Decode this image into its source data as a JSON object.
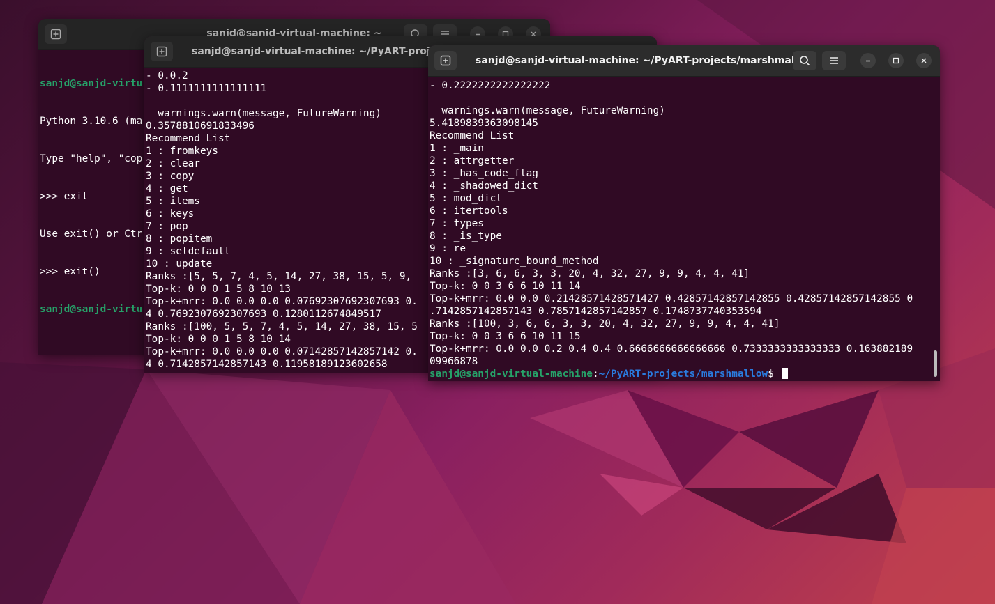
{
  "window1": {
    "title": "sanjd@sanjd-virtual-machine: ~",
    "lines": [
      {
        "user": "sanjd@sanjd-virtu",
        "text": ""
      },
      {
        "text": "Python 3.10.6 (ma"
      },
      {
        "text": "Type \"help\", \"cop"
      },
      {
        "text": ">>> exit"
      },
      {
        "text": "Use exit() or Ctr"
      },
      {
        "text": ">>> exit()"
      },
      {
        "user": "sanjd@sanjd-virtu",
        "text": ""
      }
    ]
  },
  "window2": {
    "title": "sanjd@sanjd-virtual-machine: ~/PyART-projects",
    "lines": [
      "- 0.0.2",
      "- 0.1111111111111111",
      "",
      "  warnings.warn(message, FutureWarning)",
      "0.3578810691833496",
      "Recommend List",
      "1 : fromkeys",
      "2 : clear",
      "3 : copy",
      "4 : get",
      "5 : items",
      "6 : keys",
      "7 : pop",
      "8 : popitem",
      "9 : setdefault",
      "10 : update",
      "Ranks :[5, 5, 7, 4, 5, 14, 27, 38, 15, 5, 9,",
      "Top-k: 0 0 0 1 5 8 10 13",
      "Top-k+mrr: 0.0 0.0 0.0 0.07692307692307693 0.",
      "4 0.7692307692307693 0.1280112674849517",
      "Ranks :[100, 5, 5, 7, 4, 5, 14, 27, 38, 15, 5",
      "Top-k: 0 0 0 1 5 8 10 14",
      "Top-k+mrr: 0.0 0.0 0.0 0.07142857142857142 0.",
      "4 0.7142857142857143 0.11958189123602658"
    ]
  },
  "window3": {
    "title": "sanjd@sanjd-virtual-machine: ~/PyART-projects/marshmallow",
    "lines": [
      "- 0.2222222222222222",
      "",
      "  warnings.warn(message, FutureWarning)",
      "5.4189839363098145",
      "Recommend List",
      "1 : _main",
      "2 : attrgetter",
      "3 : _has_code_flag",
      "4 : _shadowed_dict",
      "5 : mod_dict",
      "6 : itertools",
      "7 : types",
      "8 : _is_type",
      "9 : re",
      "10 : _signature_bound_method",
      "Ranks :[3, 6, 6, 3, 3, 20, 4, 32, 27, 9, 9, 4, 4, 41]",
      "Top-k: 0 0 3 6 6 10 11 14",
      "Top-k+mrr: 0.0 0.0 0.21428571428571427 0.42857142857142855 0.42857142857142855 0",
      ".7142857142857143 0.7857142857142857 0.1748737740353594",
      "Ranks :[100, 3, 6, 6, 3, 3, 20, 4, 32, 27, 9, 9, 4, 4, 41]",
      "Top-k: 0 0 3 6 6 10 11 15",
      "Top-k+mrr: 0.0 0.0 0.2 0.4 0.4 0.6666666666666666 0.7333333333333333 0.163882189",
      "09966878"
    ],
    "prompt_user": "sanjd@sanjd-virtual-machine",
    "prompt_sep": ":",
    "prompt_path": "~/PyART-projects/marshmallow",
    "prompt_dollar": "$ "
  },
  "icons": {
    "new_tab": "new-tab-icon",
    "search": "search-icon",
    "menu": "hamburger-menu-icon",
    "minimize": "minimize-icon",
    "maximize": "maximize-icon",
    "close": "close-icon"
  },
  "colors": {
    "terminal_bg": "#300a24",
    "prompt_user": "#26a269",
    "prompt_path": "#2a7bde",
    "titlebar": "#2c2c2c"
  }
}
